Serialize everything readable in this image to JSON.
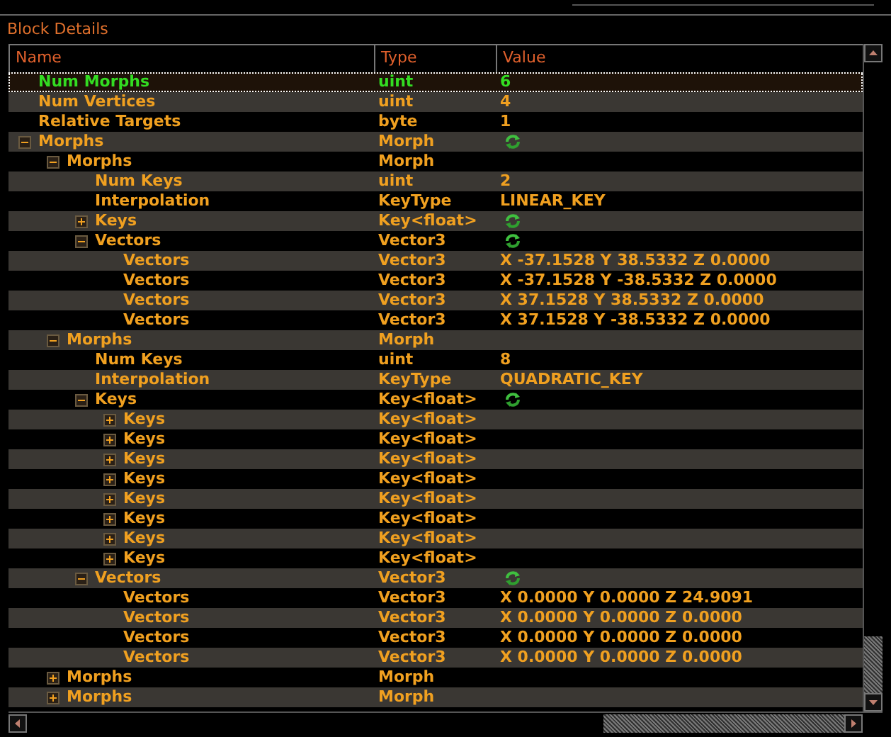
{
  "panel": {
    "title": "Block Details"
  },
  "columns": [
    "Name",
    "Type",
    "Value"
  ],
  "rows": [
    {
      "name": "Num Morphs",
      "type": "uint",
      "value": "6",
      "selected": true
    },
    {
      "name": "Num Vertices",
      "type": "uint",
      "value": "4",
      "selected": false
    },
    {
      "name": "Relative Targets",
      "type": "byte",
      "value": "1",
      "selected": false
    },
    {
      "name": "Morphs",
      "type": "Morph",
      "value_icon": true,
      "selected": false,
      "expanded": true,
      "children": [
        {
          "name": "Morphs",
          "type": "Morph",
          "selected": false,
          "expanded": true,
          "children": [
            {
              "name": "Num Keys",
              "type": "uint",
              "value": "2",
              "selected": false
            },
            {
              "name": "Interpolation",
              "type": "KeyType",
              "value": "LINEAR_KEY",
              "selected": false
            },
            {
              "name": "Keys",
              "type": "Key<float>",
              "value_icon": true,
              "selected": false,
              "expanded": false
            },
            {
              "name": "Vectors",
              "type": "Vector3",
              "value_icon": true,
              "selected": false,
              "expanded": true,
              "children": [
                {
                  "name": "Vectors",
                  "type": "Vector3",
                  "value": "X -37.1528 Y 38.5332 Z 0.0000",
                  "selected": false
                },
                {
                  "name": "Vectors",
                  "type": "Vector3",
                  "value": "X -37.1528 Y -38.5332 Z 0.0000",
                  "selected": false
                },
                {
                  "name": "Vectors",
                  "type": "Vector3",
                  "value": "X 37.1528 Y 38.5332 Z 0.0000",
                  "selected": false
                },
                {
                  "name": "Vectors",
                  "type": "Vector3",
                  "value": "X 37.1528 Y -38.5332 Z 0.0000",
                  "selected": false
                }
              ]
            }
          ]
        },
        {
          "name": "Morphs",
          "type": "Morph",
          "selected": false,
          "expanded": true,
          "children": [
            {
              "name": "Num Keys",
              "type": "uint",
              "value": "8",
              "selected": false
            },
            {
              "name": "Interpolation",
              "type": "KeyType",
              "value": "QUADRATIC_KEY",
              "selected": false
            },
            {
              "name": "Keys",
              "type": "Key<float>",
              "value_icon": true,
              "selected": false,
              "expanded": true,
              "children": [
                {
                  "name": "Keys",
                  "type": "Key<float>",
                  "selected": false,
                  "expanded": false
                },
                {
                  "name": "Keys",
                  "type": "Key<float>",
                  "selected": false,
                  "expanded": false
                },
                {
                  "name": "Keys",
                  "type": "Key<float>",
                  "selected": false,
                  "expanded": false
                },
                {
                  "name": "Keys",
                  "type": "Key<float>",
                  "selected": false,
                  "expanded": false
                },
                {
                  "name": "Keys",
                  "type": "Key<float>",
                  "selected": false,
                  "expanded": false
                },
                {
                  "name": "Keys",
                  "type": "Key<float>",
                  "selected": false,
                  "expanded": false
                },
                {
                  "name": "Keys",
                  "type": "Key<float>",
                  "selected": false,
                  "expanded": false
                },
                {
                  "name": "Keys",
                  "type": "Key<float>",
                  "selected": false,
                  "expanded": false
                }
              ]
            },
            {
              "name": "Vectors",
              "type": "Vector3",
              "value_icon": true,
              "selected": false,
              "expanded": true,
              "children": [
                {
                  "name": "Vectors",
                  "type": "Vector3",
                  "value": "X 0.0000 Y 0.0000 Z 24.9091",
                  "selected": false
                },
                {
                  "name": "Vectors",
                  "type": "Vector3",
                  "value": "X 0.0000 Y 0.0000 Z 0.0000",
                  "selected": false
                },
                {
                  "name": "Vectors",
                  "type": "Vector3",
                  "value": "X 0.0000 Y 0.0000 Z 0.0000",
                  "selected": false
                },
                {
                  "name": "Vectors",
                  "type": "Vector3",
                  "value": "X 0.0000 Y 0.0000 Z 0.0000",
                  "selected": false
                }
              ]
            }
          ]
        },
        {
          "name": "Morphs",
          "type": "Morph",
          "selected": false,
          "expanded": false
        },
        {
          "name": "Morphs",
          "type": "Morph",
          "selected": false,
          "expanded": false
        }
      ]
    }
  ]
}
